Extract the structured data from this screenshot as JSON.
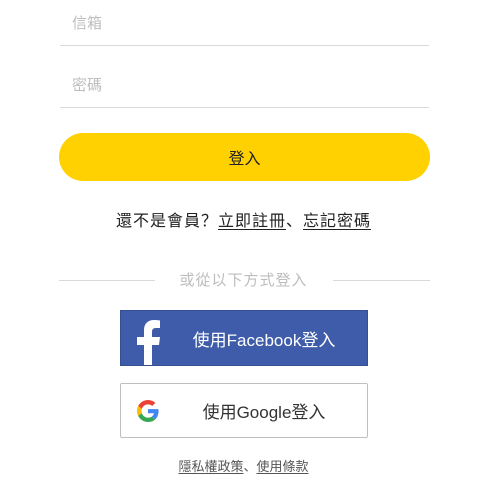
{
  "form": {
    "email_placeholder": "信箱",
    "password_placeholder": "密碼",
    "login_label": "登入"
  },
  "register": {
    "prompt": "還不是會員？",
    "register_link": "立即註冊",
    "separator": "、",
    "forgot_link": "忘記密碼"
  },
  "divider": {
    "text": "或從以下方式登入"
  },
  "social": {
    "facebook_label": "使用Facebook登入",
    "facebook_icon": "facebook-icon",
    "facebook_color": "#3e5ca9",
    "google_label": "使用Google登入",
    "google_icon": "google-icon"
  },
  "footer": {
    "privacy_link": "隱私權政策",
    "separator": "、",
    "terms_link": "使用條款"
  },
  "colors": {
    "primary": "#ffd100"
  }
}
